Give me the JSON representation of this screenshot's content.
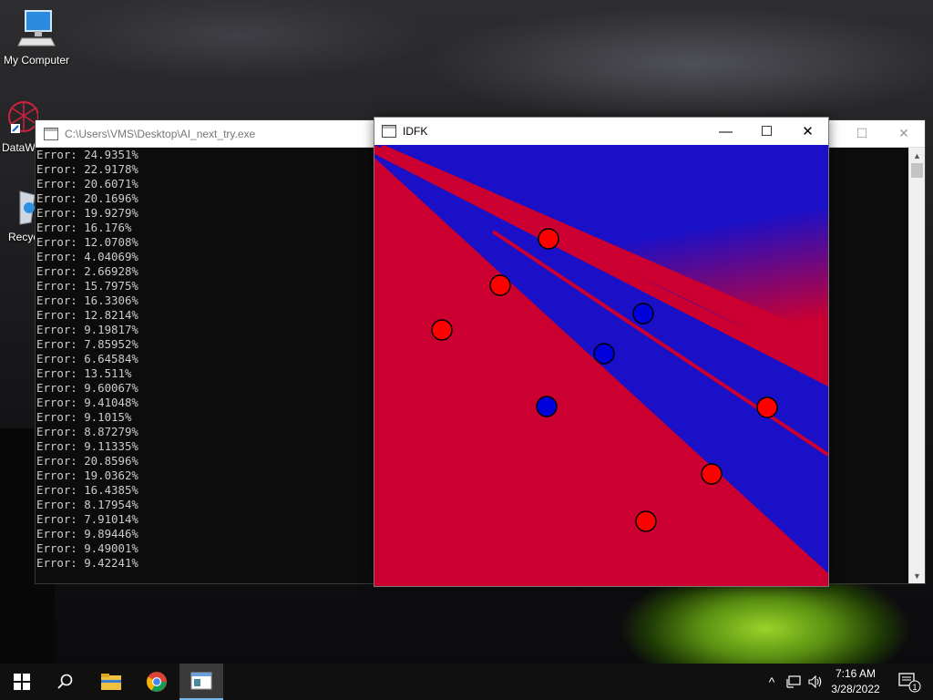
{
  "desktop": {
    "icons": [
      {
        "label": "My Computer"
      },
      {
        "label": "DataW"
      },
      {
        "label": "Recyc"
      }
    ]
  },
  "console": {
    "title": "C:\\Users\\VMS\\Desktop\\AI_next_try.exe",
    "lines": [
      "Error: 24.9351%",
      "Error: 22.9178%",
      "Error: 20.6071%",
      "Error: 20.1696%",
      "Error: 19.9279%",
      "Error: 16.176%",
      "Error: 12.0708%",
      "Error: 4.04069%",
      "Error: 2.66928%",
      "Error: 15.7975%",
      "Error: 16.3306%",
      "Error: 12.8214%",
      "Error: 9.19817%",
      "Error: 7.85952%",
      "Error: 6.64584%",
      "Error: 13.511%",
      "Error: 9.60067%",
      "Error: 9.41048%",
      "Error: 9.1015%",
      "Error: 8.87279%",
      "Error: 9.11335%",
      "Error: 20.8596%",
      "Error: 19.0362%",
      "Error: 16.4385%",
      "Error: 8.17954%",
      "Error: 7.91014%",
      "Error: 9.89446%",
      "Error: 9.49001%",
      "Error: 9.42241%"
    ]
  },
  "idfk": {
    "title": "IDFK",
    "minimize": "—",
    "maximize": "☐",
    "close": "✕",
    "colors": {
      "red": "#cc0030",
      "blue": "#1a10c8",
      "point_red": "#ff0000",
      "point_blue": "#0000dd"
    }
  },
  "taskbar": {
    "time": "7:16 AM",
    "date": "3/28/2022",
    "notification_count": "1"
  }
}
